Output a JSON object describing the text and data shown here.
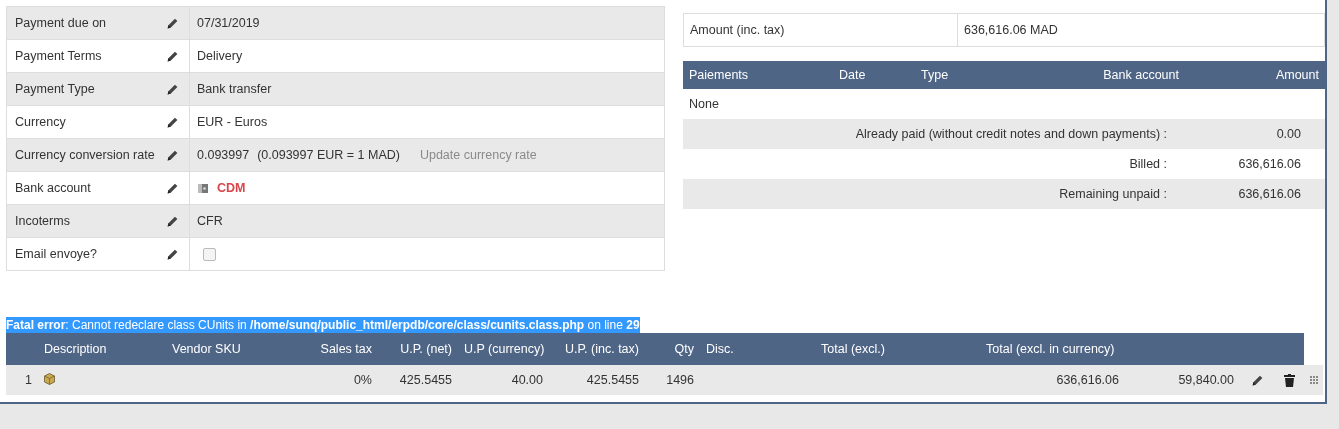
{
  "fields": [
    {
      "label": "Payment due on",
      "kind": "text",
      "value": "07/31/2019"
    },
    {
      "label": "Payment Terms",
      "kind": "text",
      "value": "Delivery"
    },
    {
      "label": "Payment Type",
      "kind": "text",
      "value": "Bank transfer"
    },
    {
      "label": "Currency",
      "kind": "text",
      "value": "EUR - Euros"
    },
    {
      "label": "Currency conversion rate",
      "kind": "rate",
      "value": "0.093997",
      "note": "(0.093997 EUR = 1 MAD)",
      "link": "Update currency rate"
    },
    {
      "label": "Bank account",
      "kind": "bank",
      "value": "CDM"
    },
    {
      "label": "Incoterms",
      "kind": "text",
      "value": "CFR"
    },
    {
      "label": "Email envoye?",
      "kind": "checkbox",
      "checked": false
    }
  ],
  "totals": [
    {
      "label": "Amount (inc. tax)",
      "value": "636,616.06 MAD"
    }
  ],
  "payments": {
    "columns": [
      "Paiements",
      "Date",
      "Type",
      "Bank account",
      "Amount"
    ],
    "empty": "None",
    "summary": [
      {
        "label": "Already paid (without credit notes and down payments) :",
        "value": "0.00"
      },
      {
        "label": "Billed :",
        "value": "636,616.06"
      },
      {
        "label": "Remaining unpaid :",
        "value": "636,616.06"
      }
    ]
  },
  "error": "**Fatal error**: Cannot redeclare class CUnits in **/home/sunq/public_html/erpdb/core/class/cunits.class.php** on line **29**",
  "lines": {
    "columns": [
      "Description",
      "Vendor SKU",
      "Sales tax",
      "U.P. (net)",
      "U.P (currency)",
      "U.P. (inc. tax)",
      "Qty",
      "Disc.",
      "Total (excl.)",
      "Total (excl. in currency)"
    ],
    "rows": [
      {
        "number": "1",
        "sales_tax": "0%",
        "up_net": "425.5455",
        "up_currency": "40.00",
        "up_inc_tax": "425.5455",
        "qty": "1496",
        "total_excl_in_currency": "636,616.06",
        "column_12": "59,840.00"
      }
    ]
  }
}
